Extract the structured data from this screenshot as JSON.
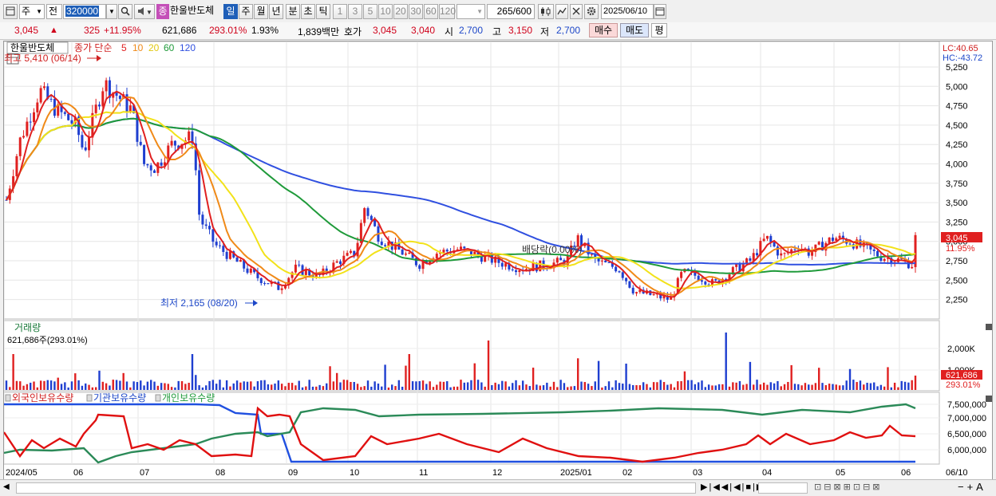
{
  "toolbar": {
    "period_select": "주",
    "mode_select": "전",
    "code": "320000",
    "name_badge": "종",
    "stock_name": "한울반도체",
    "tabs": [
      "일",
      "주",
      "월",
      "년",
      "분",
      "초",
      "틱"
    ],
    "selected_tab": "일",
    "intervals": [
      "1",
      "3",
      "5",
      "10",
      "20",
      "30",
      "60",
      "120"
    ],
    "count_display": "265",
    "count_max": "/600",
    "date": "2025/06/10"
  },
  "quote": {
    "price": "3,045",
    "arrow": "▲",
    "change": "325",
    "change_pct": "+11.95%",
    "volume": "621,686",
    "volume_pct": "293.01%",
    "turnover": "1.93%",
    "amount": "1,839백만",
    "hoga_label": "호가",
    "ask": "3,045",
    "bid": "3,040",
    "open_label": "시",
    "open": "2,700",
    "high_label": "고",
    "high": "3,150",
    "low_label": "저",
    "low": "2,700",
    "buy_label": "매수",
    "sell_label": "매도",
    "eval_label": "평"
  },
  "legend": {
    "name": "한울반도체",
    "ma_title": "종가 단순",
    "ma_periods": [
      "5",
      "10",
      "20",
      "60",
      "120"
    ]
  },
  "annotations": {
    "max": "최고 5,410 (06/14)",
    "min": "최저 2,165 (08/20)",
    "dividend": "배당락(0.00%)",
    "lc": "LC:40.65",
    "hc": "HC:-43.72",
    "price_tag": "3,045",
    "pct_tag": "11.95%"
  },
  "volume_panel": {
    "title": "거래량",
    "info": "621,686주(293.01%)",
    "tag_value": "621,686",
    "tag_pct": "293.01%",
    "yticks": [
      "2,000K",
      "1,000K"
    ]
  },
  "holdings_panel": {
    "legends": [
      "외국인보유수량",
      "기관보유수량",
      "개인보유수량"
    ],
    "yticks": [
      "7,500,000",
      "7,000,000",
      "6,500,000",
      "6,000,000"
    ]
  },
  "price_axis": [
    "5,250",
    "5,000",
    "4,750",
    "4,500",
    "4,250",
    "4,000",
    "3,750",
    "3,500",
    "3,250",
    "3,000",
    "2,750",
    "2,500",
    "2,250"
  ],
  "x_axis": [
    "2024/05",
    "06",
    "07",
    "08",
    "09",
    "10",
    "11",
    "12",
    "2025/01",
    "02",
    "03",
    "04",
    "05",
    "06"
  ],
  "x_right": "06/10",
  "colors": {
    "up": "#e02020",
    "down": "#1f3fd0",
    "ma5": "#e02020",
    "ma10": "#f08a18",
    "ma20": "#f2e21a",
    "ma60": "#1f9a3a",
    "ma120": "#3050e0"
  }
}
